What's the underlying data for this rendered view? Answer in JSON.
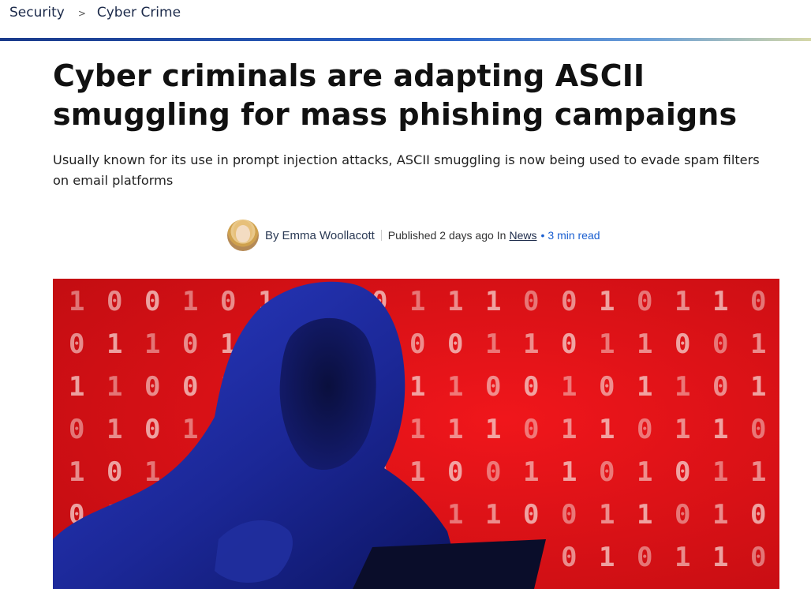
{
  "breadcrumb": {
    "items": [
      "Security",
      "Cyber Crime"
    ],
    "separator": ">"
  },
  "article": {
    "headline": "Cyber criminals are adapting ASCII smuggling for mass phishing campaigns",
    "standfirst": "Usually known for its use in prompt injection attacks, ASCII smuggling is now being used to evade spam filters on email platforms",
    "byline": {
      "by_label": "By",
      "author": "Emma Woollacott",
      "published_label": "Published",
      "published_when": "2 days ago",
      "in_label": "In",
      "category": "News",
      "bullet": "•",
      "read_time": "3 min read"
    },
    "hero": {
      "binary_rows": [
        "1 0 0 1 0 1 1 0 0 1 1 1 0 0 1 0 1 1 0",
        "0 1 1 0 1 0 0 1 1 0 0 1 1 0 1 1 0 0 1",
        "1 1 0 0 1 1 0 1 0 1 1 0 0 1 0 1 1 0 1",
        "0 1 0 1 1 0 1 0 0 1 1 1 0 1 1 0 1 1 0",
        "1 0 1 1 0 0 1 1 0 1 0 0 1 1 0 1 0 1 1",
        "0 1 1 0 1 1 0 0 1 0 1 1 0 0 1 1 0 1 0",
        "1 0 0 1 0 1 1 0 1 1 0 0 1 0 1 0 1 1 0"
      ],
      "colors": {
        "background": "#e8141a",
        "digit": "#f5c9c6",
        "hoodie": "#1f2ea8"
      }
    }
  },
  "colors": {
    "link_blue": "#1a5fd0",
    "nav_text": "#1c2a4a"
  }
}
